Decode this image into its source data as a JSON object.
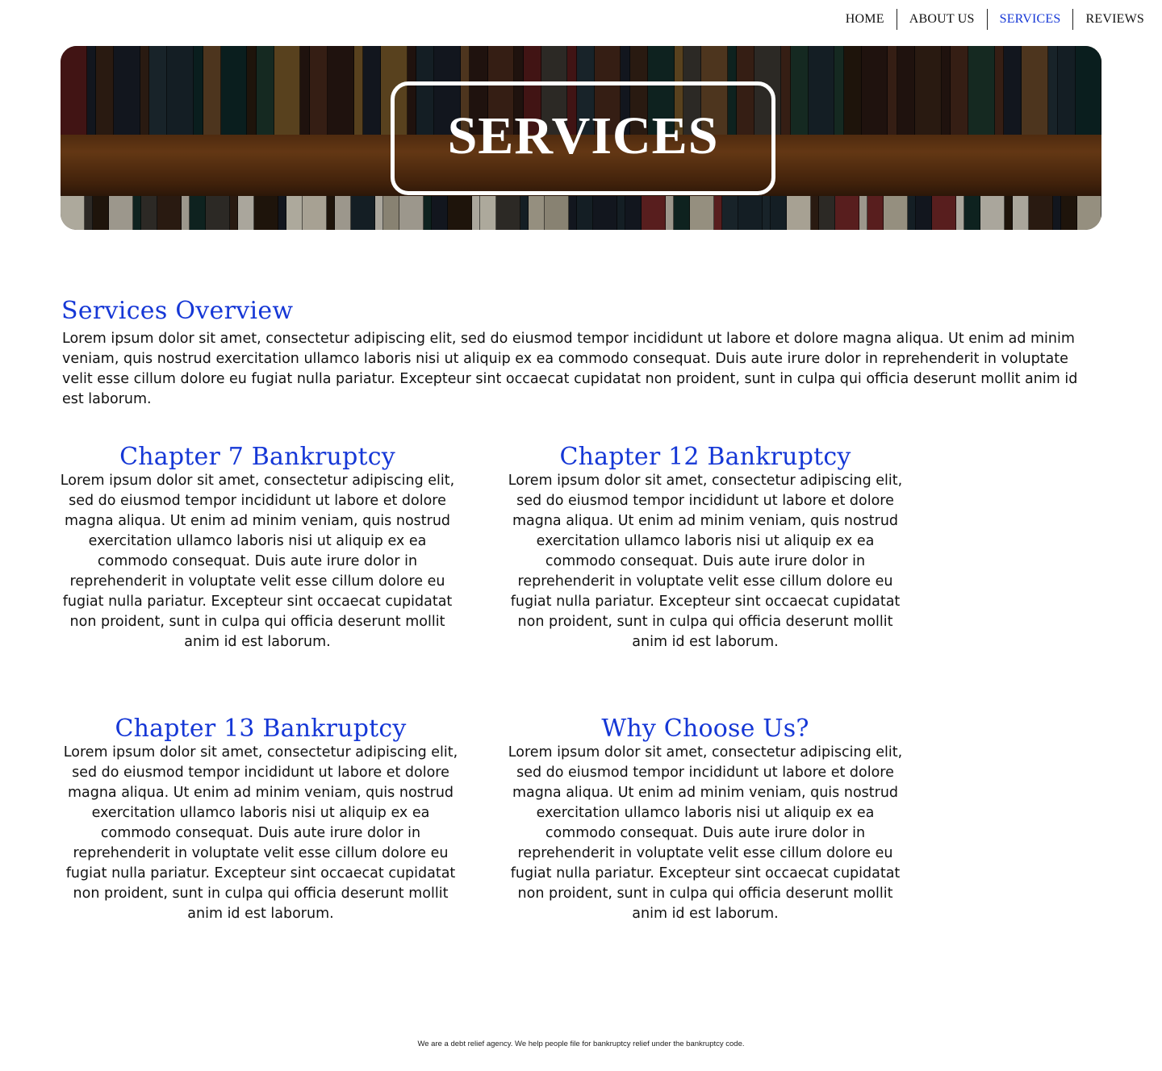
{
  "nav": {
    "items": [
      {
        "label": "HOME",
        "active": false
      },
      {
        "label": "ABOUT US",
        "active": false
      },
      {
        "label": "SERVICES",
        "active": true
      },
      {
        "label": "REVIEWS",
        "active": false
      }
    ]
  },
  "hero": {
    "title": "SERVICES"
  },
  "overview": {
    "title": "Services Overview",
    "text": "Lorem ipsum dolor sit amet, consectetur adipiscing elit, sed do eiusmod tempor incididunt ut labore et dolore magna aliqua. Ut enim ad minim veniam, quis nostrud exercitation ullamco laboris nisi ut aliquip ex ea commodo consequat. Duis aute irure dolor in reprehenderit in voluptate velit esse cillum dolore eu fugiat nulla pariatur. Excepteur sint occaecat cupidatat non proident, sunt in culpa qui officia deserunt mollit anim id est laborum."
  },
  "sections": [
    {
      "title": "Chapter 7 Bankruptcy",
      "text": "Lorem ipsum dolor sit amet, consectetur adipiscing elit, sed do eiusmod tempor incididunt ut labore et dolore magna aliqua. Ut enim ad minim veniam, quis nostrud exercitation ullamco laboris nisi ut aliquip ex ea commodo consequat. Duis aute irure dolor in reprehenderit in voluptate velit esse cillum dolore eu fugiat nulla pariatur. Excepteur sint occaecat cupidatat non proident, sunt in culpa qui officia deserunt mollit anim id est laborum."
    },
    {
      "title": "Chapter 12 Bankruptcy",
      "text": "Lorem ipsum dolor sit amet, consectetur adipiscing elit, sed do eiusmod tempor incididunt ut labore et dolore magna aliqua. Ut enim ad minim veniam, quis nostrud exercitation ullamco laboris nisi ut aliquip ex ea commodo consequat. Duis aute irure dolor in reprehenderit in voluptate velit esse cillum dolore eu fugiat nulla pariatur. Excepteur sint occaecat cupidatat non proident, sunt in culpa qui officia deserunt mollit anim id est laborum."
    },
    {
      "title": "Chapter 13 Bankruptcy",
      "text": "Lorem ipsum dolor sit amet, consectetur adipiscing elit, sed do eiusmod tempor incididunt ut labore et dolore magna aliqua. Ut enim ad minim veniam, quis nostrud exercitation ullamco laboris nisi ut aliquip ex ea commodo consequat. Duis aute irure dolor in reprehenderit in voluptate velit esse cillum dolore eu fugiat nulla pariatur. Excepteur sint occaecat cupidatat non proident, sunt in culpa qui officia deserunt mollit anim id est laborum."
    },
    {
      "title": "Why Choose Us?",
      "text": "Lorem ipsum dolor sit amet, consectetur adipiscing elit, sed do eiusmod tempor incididunt ut labore et dolore magna aliqua. Ut enim ad minim veniam, quis nostrud exercitation ullamco laboris nisi ut aliquip ex ea commodo consequat. Duis aute irure dolor in reprehenderit in voluptate velit esse cillum dolore eu fugiat nulla pariatur. Excepteur sint occaecat cupidatat non proident, sunt in culpa qui officia deserunt mollit anim id est laborum."
    }
  ],
  "footer": {
    "text": "We are a debt relief agency. We help people file for bankruptcy relief under the bankruptcy code."
  },
  "colors": {
    "accent": "#1537d6",
    "text": "#111111",
    "background": "#ffffff"
  }
}
